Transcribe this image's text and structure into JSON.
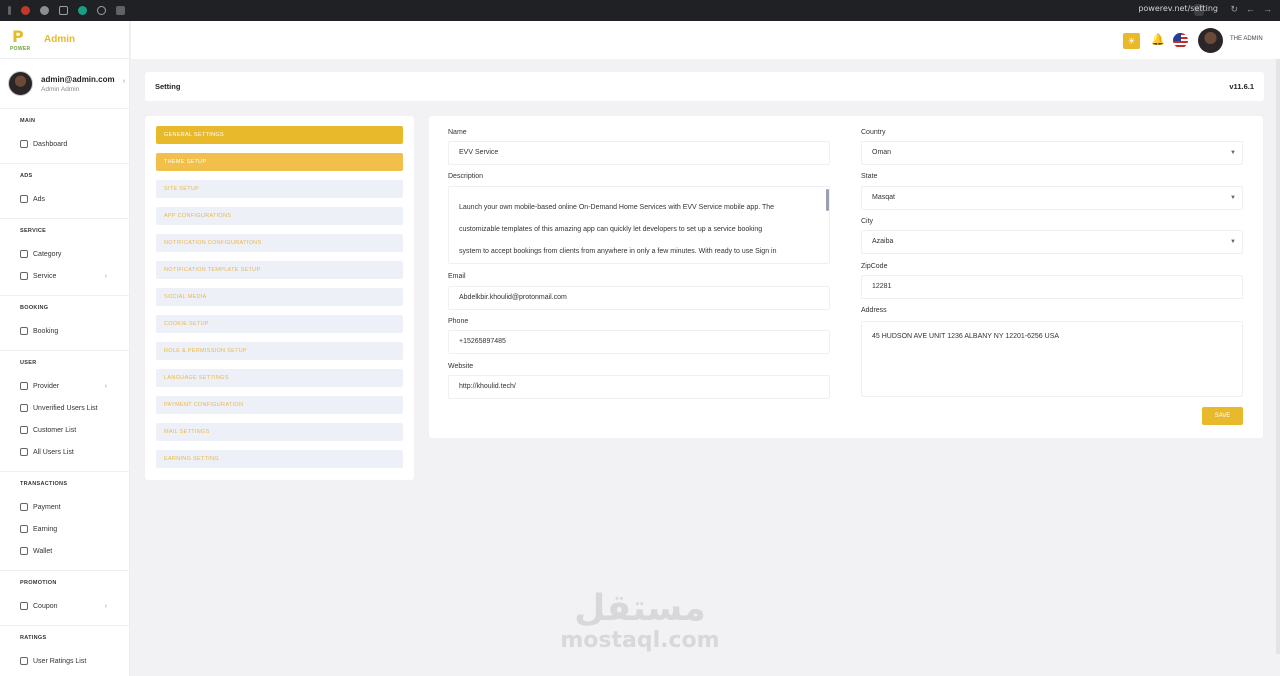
{
  "browser": {
    "url": "powerev.net/setting"
  },
  "brand": {
    "logo_letter": "P",
    "logo_text": "POWER",
    "title": "Admin"
  },
  "user": {
    "email": "admin@admin.com",
    "name": "Admin Admin"
  },
  "sidebar": {
    "sections": [
      {
        "head": "MAIN",
        "items": [
          {
            "label": "Dashboard",
            "icon": "dashboard-icon"
          }
        ]
      },
      {
        "head": "ADS",
        "items": [
          {
            "label": "Ads",
            "icon": "ads-icon"
          }
        ]
      },
      {
        "head": "SERVICE",
        "items": [
          {
            "label": "Category",
            "icon": "category-icon"
          },
          {
            "label": "Service",
            "icon": "service-icon",
            "chevron": true
          }
        ]
      },
      {
        "head": "BOOKING",
        "items": [
          {
            "label": "Booking",
            "icon": "booking-icon"
          }
        ]
      },
      {
        "head": "USER",
        "items": [
          {
            "label": "Provider",
            "icon": "provider-icon",
            "chevron": true
          },
          {
            "label": "Unverified Users List",
            "icon": "user-icon"
          },
          {
            "label": "Customer List",
            "icon": "customer-icon"
          },
          {
            "label": "All Users List",
            "icon": "users-icon"
          }
        ]
      },
      {
        "head": "TRANSACTIONS",
        "items": [
          {
            "label": "Payment",
            "icon": "payment-icon"
          },
          {
            "label": "Earning",
            "icon": "earning-icon"
          },
          {
            "label": "Wallet",
            "icon": "wallet-icon"
          }
        ]
      },
      {
        "head": "PROMOTION",
        "items": [
          {
            "label": "Coupon",
            "icon": "coupon-icon",
            "chevron": true
          }
        ]
      },
      {
        "head": "RATINGS",
        "items": [
          {
            "label": "User Ratings List",
            "icon": "rating-icon"
          }
        ]
      }
    ]
  },
  "header": {
    "user_name": "THE ADMIN"
  },
  "page": {
    "title": "Setting",
    "version": "v11.6.1"
  },
  "settings_menu": [
    {
      "label": "GENERAL SETTINGS",
      "state": "active"
    },
    {
      "label": "THEME SETUP",
      "state": "sub"
    },
    {
      "label": "SITE SETUP",
      "state": ""
    },
    {
      "label": "APP CONFIGURATIONS",
      "state": ""
    },
    {
      "label": "NOTIFICATION CONFIGURATIONS",
      "state": ""
    },
    {
      "label": "NOTIFICATION TEMPLATE SETUP",
      "state": ""
    },
    {
      "label": "SOCIAL MEDIA",
      "state": ""
    },
    {
      "label": "COOKIE SETUP",
      "state": ""
    },
    {
      "label": "ROLE & PERMISSION SETUP",
      "state": ""
    },
    {
      "label": "LANGUAGE SETTINGS",
      "state": ""
    },
    {
      "label": "PAYMENT CONFIGURATION",
      "state": ""
    },
    {
      "label": "MAIL SETTINGS",
      "state": ""
    },
    {
      "label": "EARNING SETTING",
      "state": ""
    }
  ],
  "form": {
    "name_label": "Name",
    "name_value": "EVV Service",
    "description_label": "Description",
    "description_lines": [
      "Launch your own mobile-based online On-Demand Home Services with EVV Service mobile app. The",
      "customizable templates of this amazing app can quickly let developers to set up a service booking",
      "system to accept bookings from clients from anywhere in only a few minutes. With ready to use Sign in"
    ],
    "email_label": "Email",
    "email_value": "Abdelkbir.khoulid@protonmail.com",
    "phone_label": "Phone",
    "phone_value": "+15265897485",
    "website_label": "Website",
    "website_value": "http://khoulid.tech/",
    "country_label": "Country",
    "country_value": "Oman",
    "state_label": "State",
    "state_value": "Masqat",
    "city_label": "City",
    "city_value": "Azaiba",
    "zip_label": "ZipCode",
    "zip_value": "12281",
    "address_label": "Address",
    "address_value": "45 HUDSON AVE UNIT 1236 ALBANY NY 12201-6256 USA",
    "save_label": "SAVE"
  },
  "watermark": {
    "arabic": "مستقل",
    "latin": "mostaql.com"
  },
  "colors": {
    "accent": "#e9b92c",
    "menu_inactive_bg": "#eef0f8",
    "menu_inactive_text": "#e7b84b"
  }
}
